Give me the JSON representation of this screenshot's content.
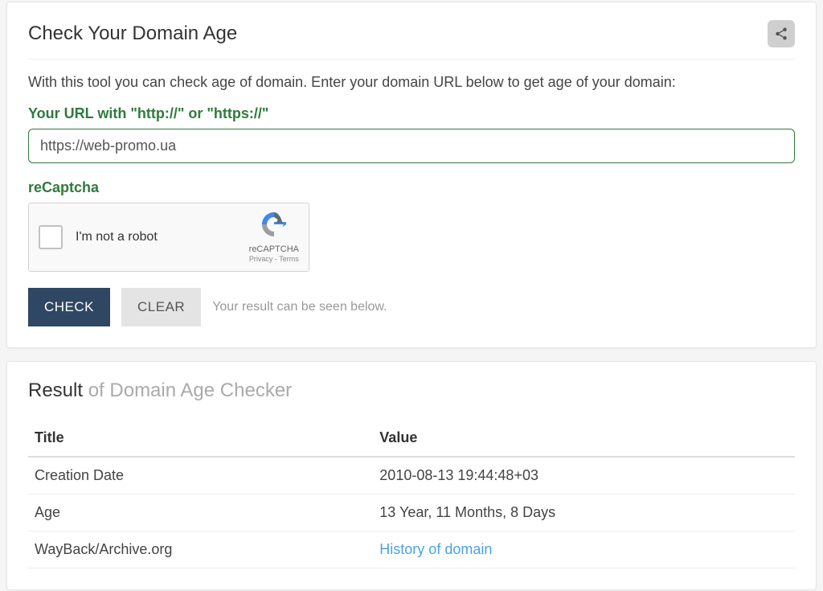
{
  "header": {
    "title": "Check Your Domain Age"
  },
  "intro": "With this tool you can check age of domain. Enter your domain URL below to get age of your domain:",
  "form": {
    "url_label": "Your URL with \"http://\" or \"https://\"",
    "url_value": "https://web-promo.ua",
    "recaptcha_label": "reCaptcha",
    "recaptcha_text": "I'm not a robot",
    "recaptcha_brand": "reCAPTCHA",
    "recaptcha_links": "Privacy - Terms",
    "check_button": "CHECK",
    "clear_button": "CLEAR",
    "hint": "Your result can be seen below."
  },
  "result": {
    "title_strong": "Result",
    "title_muted": " of Domain Age Checker",
    "columns": {
      "title": "Title",
      "value": "Value"
    },
    "rows": [
      {
        "title": "Creation Date",
        "value": "2010-08-13 19:44:48+03",
        "link": false
      },
      {
        "title": "Age",
        "value": "13 Year, 11 Months, 8 Days",
        "link": false
      },
      {
        "title": "WayBack/Archive.org",
        "value": "History of domain",
        "link": true
      }
    ]
  }
}
